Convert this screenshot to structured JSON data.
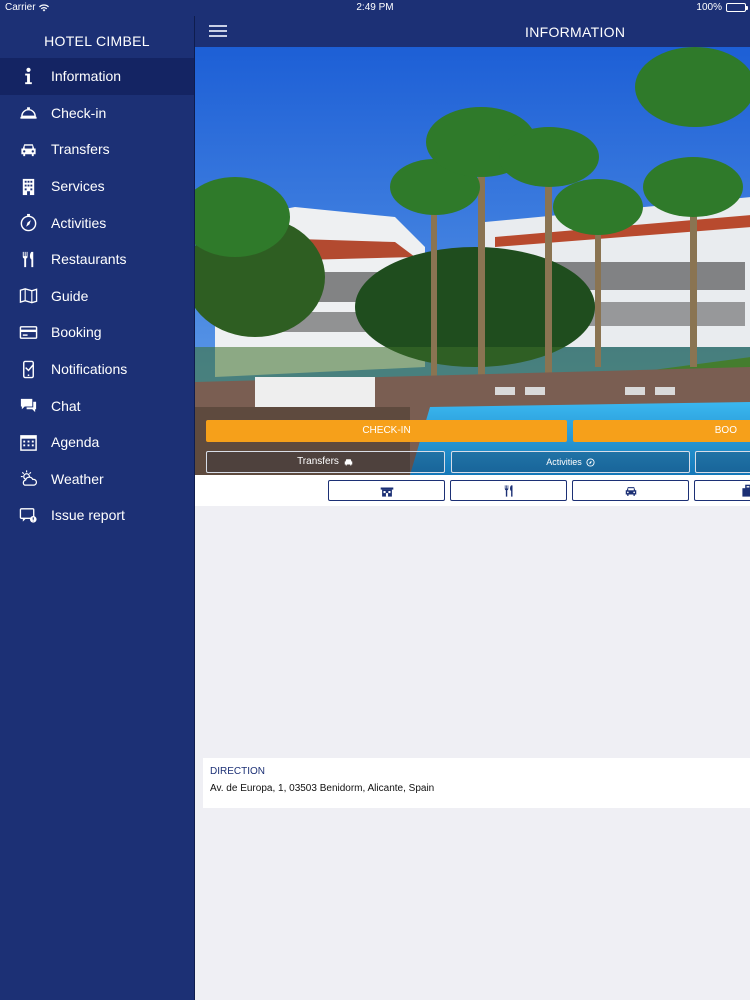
{
  "status_bar": {
    "carrier": "Carrier",
    "time": "2:49 PM",
    "battery_percent": "100%",
    "battery_level": 1.0
  },
  "sidebar": {
    "hotel_name": "HOTEL CIMBEL",
    "items": [
      {
        "label": "Information",
        "icon": "info-icon",
        "active": true
      },
      {
        "label": "Check-in",
        "icon": "bell-icon"
      },
      {
        "label": "Transfers",
        "icon": "car-icon"
      },
      {
        "label": "Services",
        "icon": "building-icon"
      },
      {
        "label": "Activities",
        "icon": "compass-icon"
      },
      {
        "label": "Restaurants",
        "icon": "cutlery-icon"
      },
      {
        "label": "Guide",
        "icon": "map-icon"
      },
      {
        "label": "Booking",
        "icon": "card-icon"
      },
      {
        "label": "Notifications",
        "icon": "phone-notification-icon"
      },
      {
        "label": "Chat",
        "icon": "chat-icon"
      },
      {
        "label": "Agenda",
        "icon": "calendar-icon"
      },
      {
        "label": "Weather",
        "icon": "weather-icon"
      },
      {
        "label": "Issue report",
        "icon": "issue-report-icon"
      }
    ]
  },
  "navbar": {
    "title": "INFORMATION"
  },
  "hero": {
    "checkin_label": "CHECK-IN",
    "booking_label": "BOO",
    "transfers_label": "Transfers",
    "activities_label": "Activities"
  },
  "iconbar": {
    "icons": [
      "building-front-icon",
      "cutlery-icon",
      "car-icon",
      "bag-icon"
    ]
  },
  "direction": {
    "label": "DIRECTION",
    "address": "Av. de Europa, 1, 03503 Benidorm, Alicante, Spain"
  },
  "colors": {
    "primary": "#1c3075",
    "accent": "#f6a01a",
    "background": "#efeff4"
  }
}
